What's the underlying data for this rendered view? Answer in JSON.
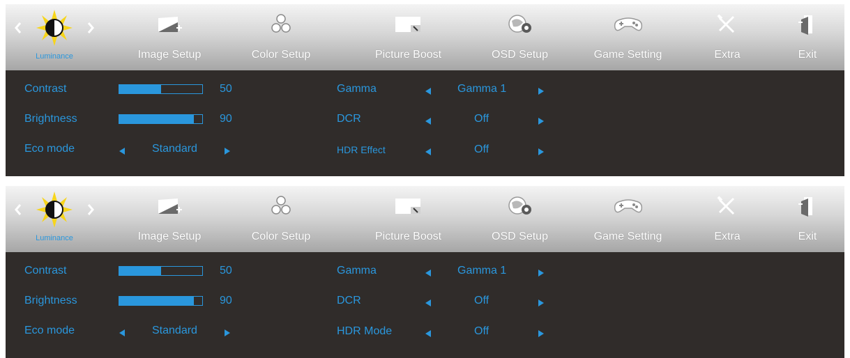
{
  "osd_top": {
    "tabs": {
      "luminance": "Luminance",
      "image_setup": "Image Setup",
      "color_setup": "Color Setup",
      "picture_boost": "Picture Boost",
      "osd_setup": "OSD Setup",
      "game_setting": "Game Setting",
      "extra": "Extra",
      "exit": "Exit"
    },
    "settings": {
      "contrast": {
        "label": "Contrast",
        "value": "50",
        "fill": 0.5
      },
      "brightness": {
        "label": "Brightness",
        "value": "90",
        "fill": 0.9
      },
      "eco_mode": {
        "label": "Eco mode",
        "value": "Standard"
      },
      "gamma": {
        "label": "Gamma",
        "value": "Gamma 1"
      },
      "dcr": {
        "label": "DCR",
        "value": "Off"
      },
      "hdr": {
        "label": "HDR Effect",
        "value": "Off"
      }
    }
  },
  "osd_bottom": {
    "tabs": {
      "luminance": "Luminance",
      "image_setup": "Image Setup",
      "color_setup": "Color Setup",
      "picture_boost": "Picture Boost",
      "osd_setup": "OSD Setup",
      "game_setting": "Game Setting",
      "extra": "Extra",
      "exit": "Exit"
    },
    "settings": {
      "contrast": {
        "label": "Contrast",
        "value": "50",
        "fill": 0.5
      },
      "brightness": {
        "label": "Brightness",
        "value": "90",
        "fill": 0.9
      },
      "eco_mode": {
        "label": "Eco mode",
        "value": "Standard"
      },
      "gamma": {
        "label": "Gamma",
        "value": "Gamma 1"
      },
      "dcr": {
        "label": "DCR",
        "value": "Off"
      },
      "hdr": {
        "label": "HDR Mode",
        "value": "Off"
      }
    }
  },
  "icons": [
    "luminance-sun-icon",
    "image-setup-icon",
    "color-setup-icon",
    "picture-boost-icon",
    "osd-setup-icon",
    "game-setting-icon",
    "extra-tools-icon",
    "exit-door-icon"
  ],
  "colors": {
    "accent": "#2a97dd",
    "panel": "#302c2a",
    "tab_text": "#ffffff",
    "sun": "#f7d51a"
  }
}
